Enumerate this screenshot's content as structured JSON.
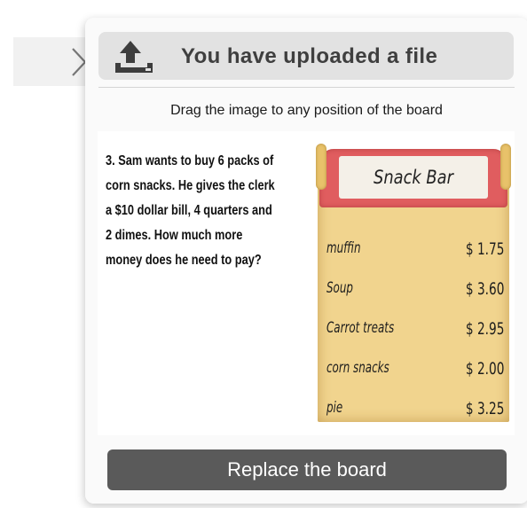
{
  "sidebar_toggle": {
    "icon": "chevron-right-icon"
  },
  "upload_header": {
    "icon": "upload-icon",
    "title": "You have uploaded a file"
  },
  "instruction": "Drag the image to any position of the board",
  "uploaded_image": {
    "question": "3.  Sam wants to buy 6 packs of corn snacks.  He gives the clerk a $10 dollar bill, 4 quarters and 2 dimes.  How much more money does he need to pay?",
    "menu": {
      "title": "Snack Bar",
      "items": [
        {
          "name": "muffin",
          "price": "$ 1.75"
        },
        {
          "name": "Soup",
          "price": "$ 3.60"
        },
        {
          "name": "Carrot treats",
          "price": "$ 2.95"
        },
        {
          "name": "corn snacks",
          "price": "$ 2.00"
        },
        {
          "name": "pie",
          "price": "$ 3.25"
        }
      ]
    }
  },
  "replace_button": "Replace the board",
  "colors": {
    "header_bg": "#e2e2e2",
    "button_bg": "#5a5a5a",
    "sign_red": "#e05d5f",
    "board_tan": "#f1d48e"
  }
}
